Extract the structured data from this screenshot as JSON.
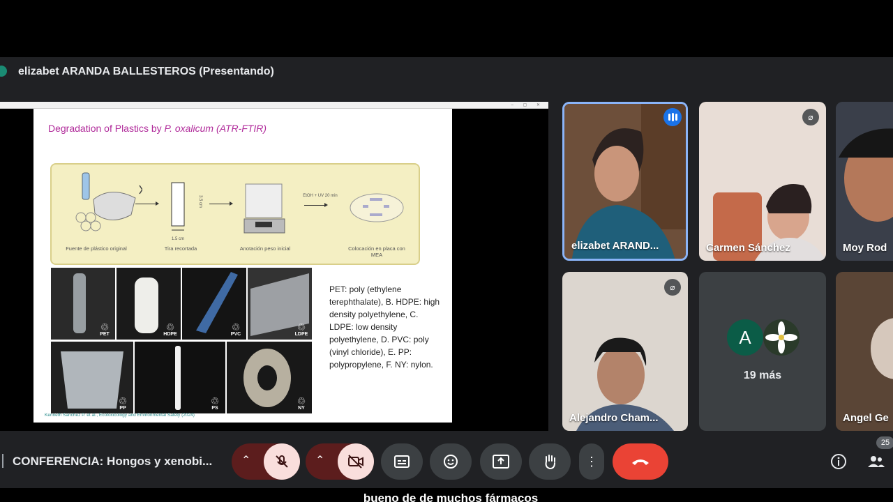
{
  "presenter": {
    "title": "elizabet ARANDA BALLESTEROS (Presentando)"
  },
  "slide": {
    "title_prefix": "Degradation of Plastics by ",
    "title_italic": "P. oxalicum (ATR-FTIR)",
    "process": {
      "captions": [
        "Fuente de plástico original",
        "Tira recortada",
        "Anotación peso inicial",
        "Colocación en placa con MEA"
      ],
      "dim_vertical": "3.5 cm",
      "dim_horizontal": "1.5 cm",
      "treatment": "EtOH + UV 20 min"
    },
    "plastics": [
      "PET",
      "HDPE",
      "PVC",
      "LDPE",
      "PP",
      "PS",
      "NY"
    ],
    "legend": "PET: poly (ethylene terephthalate), B. HDPE: high density polyethylene, C. LDPE: low density polyethylene, D. PVC: poly (vinyl chloride), E. PP: polypropylene, F. NY: nylon.",
    "citation": "Kenneth Sanchez P. et al., Ecotoxicology and Environmental Safety (2024)"
  },
  "participants": [
    {
      "name": "elizabet ARAND...",
      "speaking": true
    },
    {
      "name": "Carmen Sánchez",
      "muted": true
    },
    {
      "name": "Moy Rod"
    },
    {
      "name": "Alejandro Cham...",
      "muted": true
    },
    {
      "avatar_letter": "A",
      "more_label": "19 más"
    },
    {
      "name": "Angel Ge"
    }
  ],
  "bottom": {
    "meeting_title": "CONFERENCIA: Hongos y xenobi...",
    "participant_count": "25"
  },
  "subtitle": "bueno de de muchos fármacos",
  "colors": {
    "accent": "#8ab4f8",
    "hangup": "#ea4335",
    "muted_bg": "#f9dedc",
    "bar_bg": "#202124"
  }
}
